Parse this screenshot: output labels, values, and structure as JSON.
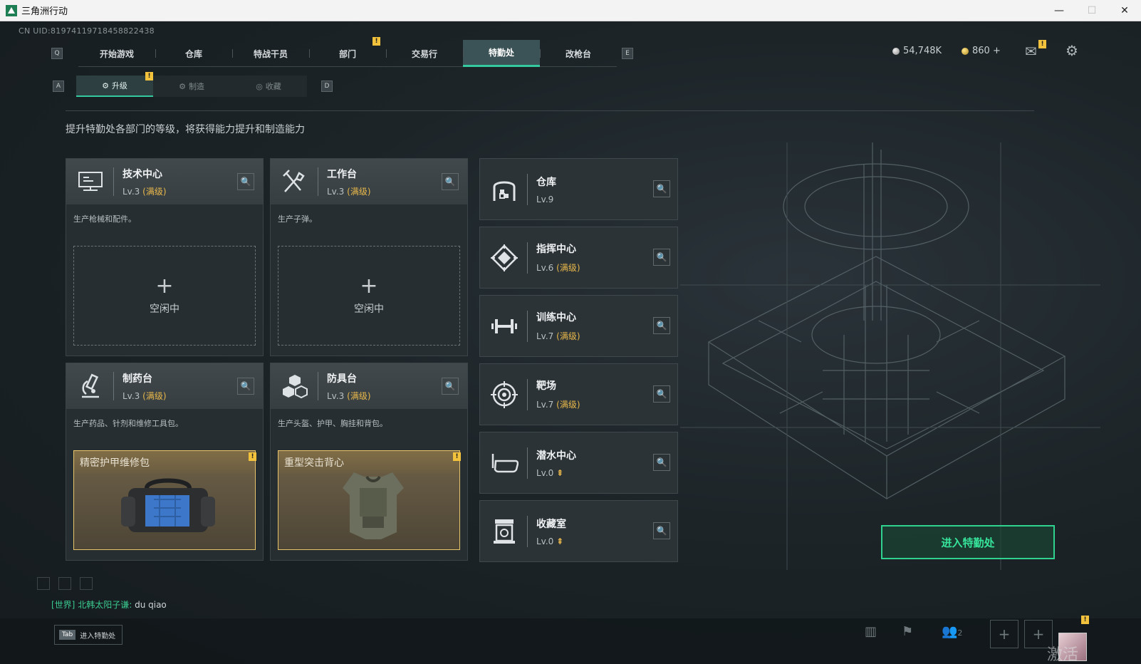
{
  "window": {
    "title": "三角洲行动",
    "min": "—",
    "max": "☐",
    "close": "✕"
  },
  "uid": "CN UID:81974119718458822438",
  "nav": {
    "left_key": "Q",
    "right_key": "E",
    "tabs": [
      "开始游戏",
      "仓库",
      "特战干员",
      "部门",
      "交易行",
      "特勤处",
      "改枪台"
    ],
    "active": "特勤处"
  },
  "currency": {
    "silver": "54,748K",
    "gold": "860 +"
  },
  "subtabs": {
    "left_key": "A",
    "right_key": "D",
    "items": [
      {
        "label": "升级",
        "icon": "upgrade-icon"
      },
      {
        "label": "制造",
        "icon": "craft-icon"
      },
      {
        "label": "收藏",
        "icon": "collect-icon"
      }
    ],
    "active": "升级"
  },
  "description": "提升特勤处各部门的等级，将获得能力提升和制造能力",
  "workstations": [
    {
      "name": "技术中心",
      "level": "Lv.3",
      "status": "(满级)",
      "desc": "生产枪械和配件。",
      "slot": {
        "state": "empty",
        "text": "空闲中"
      },
      "icon": "monitor-icon"
    },
    {
      "name": "工作台",
      "level": "Lv.3",
      "status": "(满级)",
      "desc": "生产子弹。",
      "slot": {
        "state": "empty",
        "text": "空闲中"
      },
      "icon": "tools-icon"
    },
    {
      "name": "制药台",
      "level": "Lv.3",
      "status": "(满级)",
      "desc": "生产药品、针剂和维修工具包。",
      "slot": {
        "state": "item",
        "text": "精密护甲维修包"
      },
      "icon": "microscope-icon"
    },
    {
      "name": "防具台",
      "level": "Lv.3",
      "status": "(满级)",
      "desc": "生产头盔、护甲、胸挂和背包。",
      "slot": {
        "state": "item",
        "text": "重型突击背心"
      },
      "icon": "armor-cubes-icon"
    }
  ],
  "facilities": [
    {
      "name": "仓库",
      "level": "Lv.9",
      "status": "",
      "icon": "warehouse-icon"
    },
    {
      "name": "指挥中心",
      "level": "Lv.6",
      "status": "(满级)",
      "icon": "command-icon"
    },
    {
      "name": "训练中心",
      "level": "Lv.7",
      "status": "(满级)",
      "icon": "dumbbell-icon"
    },
    {
      "name": "靶场",
      "level": "Lv.7",
      "status": "(满级)",
      "icon": "target-icon"
    },
    {
      "name": "潜水中心",
      "level": "Lv.0",
      "status": "",
      "upgrade": "⇞",
      "icon": "diving-mask-icon"
    },
    {
      "name": "收藏室",
      "level": "Lv.0",
      "status": "",
      "upgrade": "⇞",
      "icon": "collection-room-icon"
    }
  ],
  "enter_button": "进入特勤处",
  "chat": {
    "channel": "[世界]",
    "sender": "北韩太阳子谦:",
    "message": "du qiao"
  },
  "bottom": {
    "tab_key": "Tab",
    "tab_label": "进入特勤处",
    "friends_count": "2"
  },
  "watermark": "激活 Windows",
  "colors": {
    "accent": "#35c9a0",
    "max_level": "#e9b84a",
    "warning": "#f3c23c",
    "enter_button": "#2fd28f"
  }
}
